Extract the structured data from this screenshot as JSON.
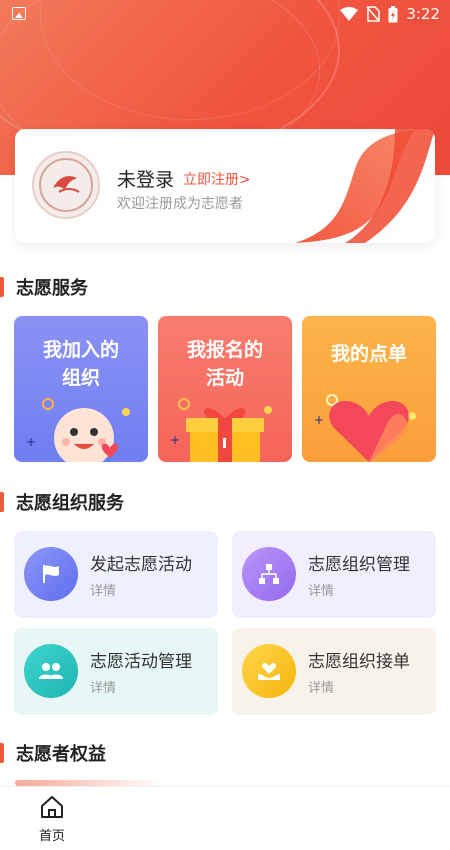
{
  "status_bar": {
    "time": "3:22"
  },
  "profile": {
    "title": "未登录",
    "register_link": "立即注册>",
    "subtitle": "欢迎注册成为志愿者"
  },
  "sections": {
    "volunteer_service": "志愿服务",
    "org_service": "志愿组织服务",
    "rights": "志愿者权益"
  },
  "service_cards": [
    {
      "line1": "我加入的",
      "line2": "组织"
    },
    {
      "line1": "我报名的",
      "line2": "活动"
    },
    {
      "line1": "我的点单",
      "line2": ""
    }
  ],
  "org_cards": [
    {
      "title": "发起志愿活动",
      "sub": "详情",
      "icon": "flag-icon",
      "bg": "#eef0fe",
      "accent": "#6f7cf2"
    },
    {
      "title": "志愿组织管理",
      "sub": "详情",
      "icon": "org-chart-icon",
      "bg": "#f3eefe",
      "accent": "#a77cf3"
    },
    {
      "title": "志愿活动管理",
      "sub": "详情",
      "icon": "people-icon",
      "bg": "#e6f7f5",
      "accent": "#2bc6c0"
    },
    {
      "title": "志愿组织接单",
      "sub": "详情",
      "icon": "heart-hand-icon",
      "bg": "#f7f3ea",
      "accent": "#f8be1d"
    }
  ],
  "bottom_nav": {
    "home_label": "首页"
  },
  "colors": {
    "accent": "#ef5a3c"
  }
}
